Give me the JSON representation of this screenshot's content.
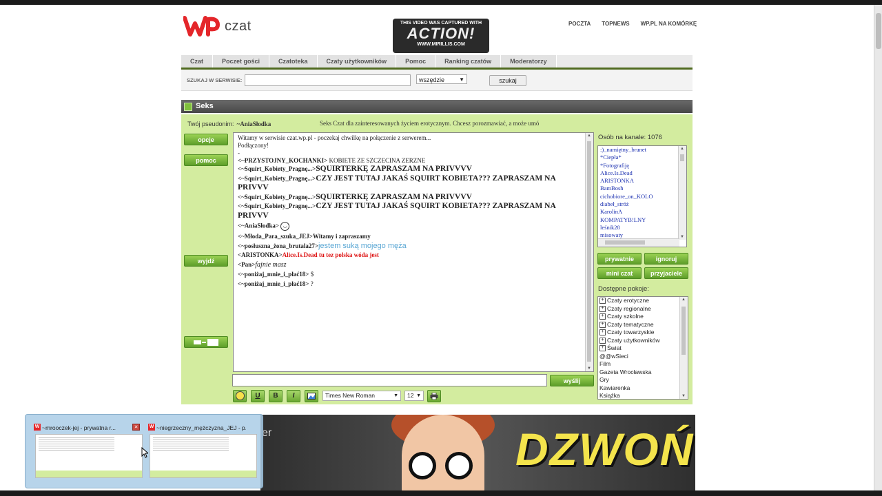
{
  "header": {
    "logo_text": "czat",
    "toplinks": [
      "POCZTA",
      "TOPNEWS",
      "WP.PL NA KOMÓRKĘ"
    ]
  },
  "watermark": {
    "line1": "THIS VIDEO WAS CAPTURED WITH",
    "line2": "ACTION!",
    "line3": "WWW.MIRILLIS.COM"
  },
  "nav": [
    "Czat",
    "Poczet gości",
    "Czatoteka",
    "Czaty użytkowników",
    "Pomoc",
    "Ranking czatów",
    "Moderatorzy"
  ],
  "search": {
    "label": "SZUKAJ W SERWISIE:",
    "value": "",
    "scope": "wszędzie",
    "button": "szukaj"
  },
  "room": {
    "title": "Seks",
    "nick_label": "Twój pseudonim:",
    "nick": "~AniaSłodka",
    "topic": "Seks Czat dla zainteresowanych życiem erotycznym. Chcesz porozmawiać, a może umó"
  },
  "left_buttons": {
    "options": "opcje",
    "help": "pomoc",
    "exit": "wyjdź"
  },
  "messages": {
    "m0": "Witamy w serwisie czat.wp.pl - poczekaj chwilkę na połączenie z serwerem...",
    "m1": "Podłączony!",
    "m2": "-",
    "m3_nick": "<~PRZYSTOJNY_KOCHANKI>",
    "m3_text": " KOBIETE ZE SZCZECINA ZERZNE",
    "m4_nick": "<~Squirt_Kobiety_Pragnę...>",
    "m4_text": "SQUIRTERKĘ ZAPRASZAM NA PRIVVVV",
    "m5_nick": "<~Squirt_Kobiety_Pragnę...>",
    "m5_text": "CZY JEST TUTAJ JAKAŚ SQUIRT KOBIETA??? ZAPRASZAM NA PRIVVV",
    "m6_nick": "<~Squirt_Kobiety_Pragnę...>",
    "m6_text": "SQUIRTERKĘ ZAPRASZAM NA PRIVVVV",
    "m7_nick": "<~Squirt_Kobiety_Pragnę...>",
    "m7_text": "CZY JEST TUTAJ JAKAŚ SQUIRT KOBIETA??? ZAPRASZAM NA PRIVVV",
    "m8_nick": "<~AniaSłodka>",
    "m9_nick": "<~Młoda_Para_szuka_JEJ>",
    "m9_text": "Witamy i zapraszamy",
    "m10_nick": "<~posłuszna_żona_brutala27>",
    "m10_text": "jestem suką mojego męża",
    "m11_nick": "<ARISTONKA>",
    "m11_text": "Alice.Is.Dead tu tez polska wóda jest",
    "m12_nick": "<Pan>",
    "m12_text": "fajnie masz",
    "m13_nick": "<~poniżaj_mnie_i_płać18>",
    "m13_text": " $",
    "m14_nick": "<~poniżaj_mnie_i_płać18>",
    "m14_text": " ?"
  },
  "composer": {
    "value": "",
    "send": "wyślij",
    "font": "Times New Roman",
    "size": "12",
    "underline": "U",
    "bold": "B",
    "italic": "I"
  },
  "users": {
    "title": "Osób na kanale: 1076",
    "list": [
      ":)_namiętny_brunet",
      "*Ciepła*",
      "*Fotografiję",
      "Alice.Is.Dead",
      "ARISTONKA",
      "BamBosh",
      "cichobiore_on_KOLO",
      "diabeł_stróż",
      "KarolinA",
      "KOMPATYB!LNY",
      "leśnik28",
      "misowaty"
    ]
  },
  "user_buttons": {
    "private": "prywatnie",
    "ignore": "ignoruj",
    "mini": "mini czat",
    "friends": "przyjaciele"
  },
  "rooms": {
    "title": "Dostępne pokoje:",
    "categories": [
      "Czaty erotyczne",
      "Czaty regionalne",
      "Czaty szkolne",
      "Czaty tematyczne",
      "Czaty towarzyskie",
      "Czaty użytkowników",
      "Świat"
    ],
    "items": [
      "@@wSieci",
      "Film",
      "Gazeta Wrocławska",
      "Gry",
      "Kawiarenka",
      "Książka"
    ]
  },
  "taskbar_previews": [
    {
      "title": "~mrooczek-jej - prywatna r..."
    },
    {
      "title": "~niegrzeczny_mężczyzna_JEJ - p..."
    }
  ],
  "banner": {
    "fragment": "er",
    "headline": "DZWOŃ!"
  },
  "colors": {
    "panel_green": "#d3ec9f",
    "button_green": "#6aa733",
    "nav_line": "#4f6a1f",
    "user_link": "#1a2fb0",
    "brand_red": "#e4262a"
  }
}
